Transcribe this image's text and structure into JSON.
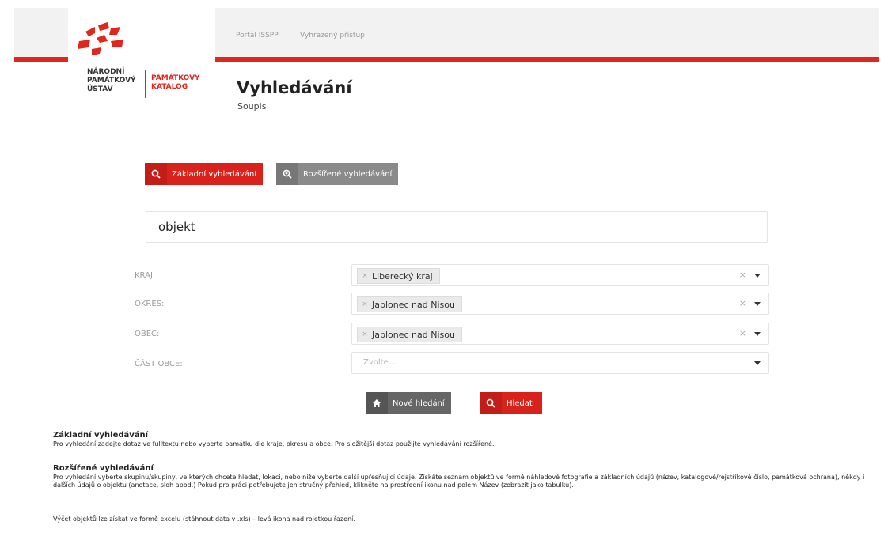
{
  "org": {
    "name_lines": [
      "NÁRODNÍ",
      "PAMÁTKOVÝ",
      "ÚSTAV"
    ],
    "catalog_lines": [
      "PAMÁTKOVÝ",
      "KATALOG"
    ]
  },
  "nav": {
    "items": [
      {
        "label": "Portál ISSPP"
      },
      {
        "label": "Vyhrazený přístup"
      }
    ]
  },
  "page": {
    "title": "Vyhledávání",
    "subtitle": "Soupis"
  },
  "tabs": {
    "basic": "Základní vyhledávání",
    "advanced": "Rozšířené vyhledávání"
  },
  "search": {
    "value": "objekt"
  },
  "filters": {
    "kraj": {
      "label": "KRAJ:",
      "value": "Liberecký kraj",
      "clear": "×"
    },
    "okres": {
      "label": "OKRES:",
      "value": "Jablonec nad Nisou",
      "clear": "×"
    },
    "obec": {
      "label": "OBEC:",
      "value": "Jablonec nad Nisou",
      "clear": "×"
    },
    "cast_obce": {
      "label": "ČÁST OBCE:",
      "placeholder": "Zvolte..."
    }
  },
  "actions": {
    "new_search": "Nové hledání",
    "search": "Hledat"
  },
  "help": {
    "basic_title": "Základní vyhledávání",
    "basic_text": "Pro vyhledání zadejte dotaz ve fulltextu nebo vyberte památku dle kraje, okresu a obce. Pro složitější dotaz použijte vyhledávání rozšířené.",
    "advanced_title": "Rozšířené vyhledávání",
    "advanced_text": "Pro vyhledání vyberte skupinu/skupiny, ve kterých chcete hledat, lokaci, nebo níže vyberte další upřesňující údaje. Získáte seznam objektů ve formě náhledové fotografie a základních údajů (název, katalogové/rejstříkové číslo, památková ochrana), někdy i dalších údajů o objektu (anotace, sloh apod.) Pokud pro práci potřebujete jen stručný přehled, klikněte na prostřední ikonu nad polem Název (zobrazit jako tabulku).",
    "export_text": "Výčet objektů lze získat ve formě excelu (stáhnout data v .xls) – levá ikona nad roletkou řazení."
  },
  "colors": {
    "accent": "#e1261c",
    "gray_button": "#8a8a8a"
  }
}
